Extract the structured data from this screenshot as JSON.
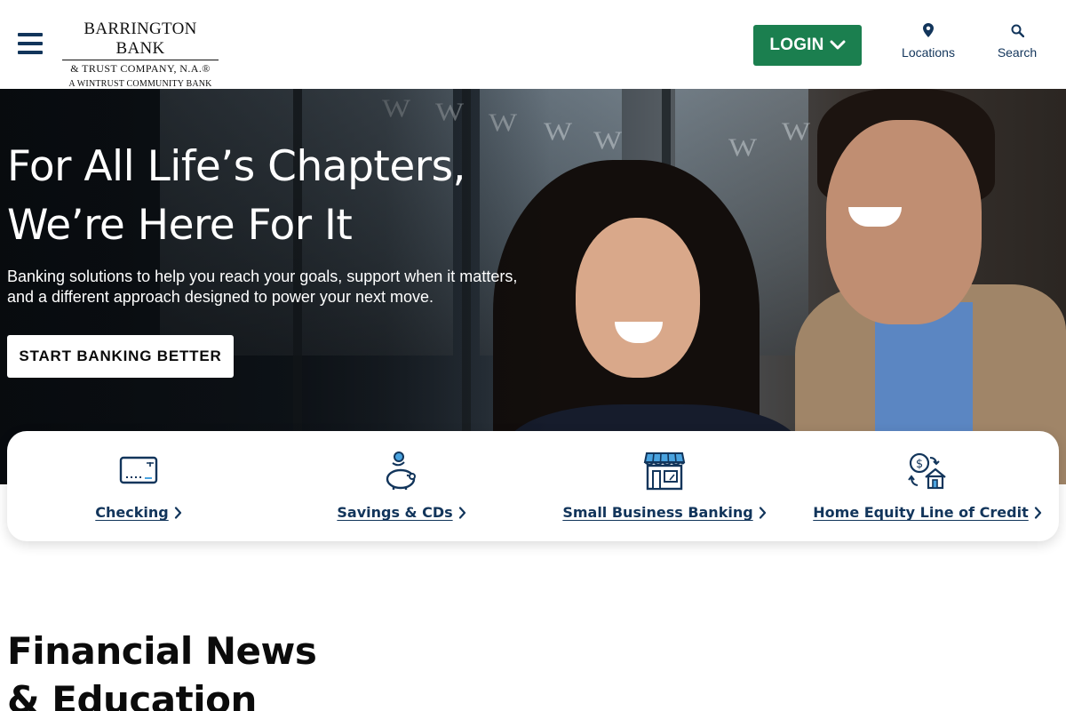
{
  "header": {
    "logo": {
      "line1": "BARRINGTON BANK",
      "line2": "& TRUST COMPANY, N.A.®",
      "line3": "A WINTRUST COMMUNITY BANK"
    },
    "login_label": "LOGIN",
    "locations_label": "Locations",
    "search_label": "Search",
    "colors": {
      "brand_navy": "#12355b",
      "login_green": "#1b7f4f"
    }
  },
  "hero": {
    "title_line1": "For All Life’s Chapters,",
    "title_line2": "We’re Here For It",
    "subtitle_line1": "Banking solutions to help you reach your goals, support when it matters,",
    "subtitle_line2": "and a different approach designed to power your next move.",
    "cta_label": "START BANKING BETTER"
  },
  "quick_links": [
    {
      "label": "Checking",
      "icon": "card-icon"
    },
    {
      "label": "Savings & CDs",
      "icon": "piggy-bank-icon"
    },
    {
      "label": "Small Business Banking",
      "icon": "storefront-icon"
    },
    {
      "label": "Home Equity Line of Credit",
      "icon": "home-equity-icon"
    }
  ],
  "news": {
    "heading_line1": "Financial News",
    "heading_line2": "& Education"
  }
}
